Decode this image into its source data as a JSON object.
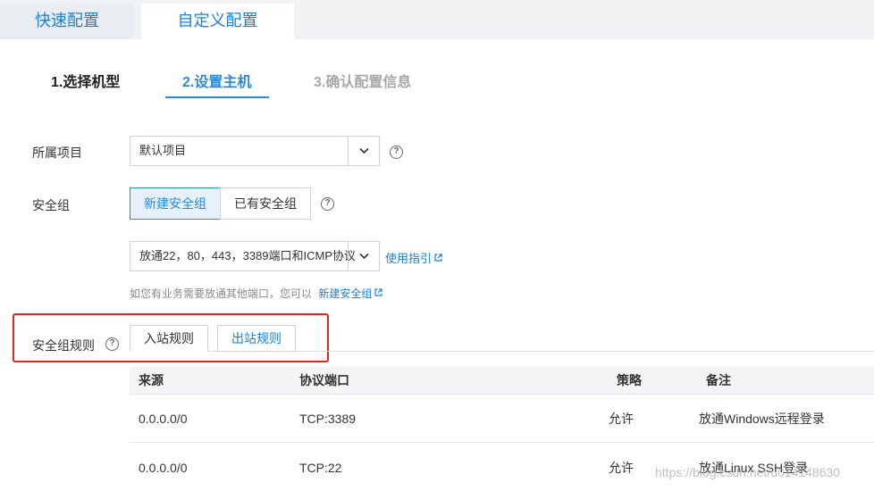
{
  "top_tabs": {
    "quick": "快速配置",
    "custom": "自定义配置"
  },
  "steps": [
    "1.选择机型",
    "2.设置主机",
    "3.确认配置信息"
  ],
  "project": {
    "label": "所属项目",
    "value": "默认项目"
  },
  "security_group": {
    "label": "安全组",
    "new_label": "新建安全组",
    "existing_label": "已有安全组",
    "template_value": "放通22，80，443，3389端口和ICMP协议",
    "guide_link": "使用指引",
    "hint_text": "如您有业务需要放通其他端口，您可以",
    "hint_link": "新建安全组"
  },
  "rules": {
    "label": "安全组规则",
    "inbound_tab": "入站规则",
    "outbound_tab": "出站规则",
    "columns": [
      "来源",
      "协议端口",
      "策略",
      "备注"
    ],
    "rows": [
      {
        "source": "0.0.0.0/0",
        "port": "TCP:3389",
        "policy": "允许",
        "note": "放通Windows远程登录"
      },
      {
        "source": "0.0.0.0/0",
        "port": "TCP:22",
        "policy": "允许",
        "note": "放通Linux SSH登录"
      }
    ]
  },
  "watermark": "https://blog.csdn.net/u014148630",
  "colors": {
    "accent": "#2b8ad8",
    "link": "#1e7fd0",
    "highlight_box": "#e02424"
  }
}
